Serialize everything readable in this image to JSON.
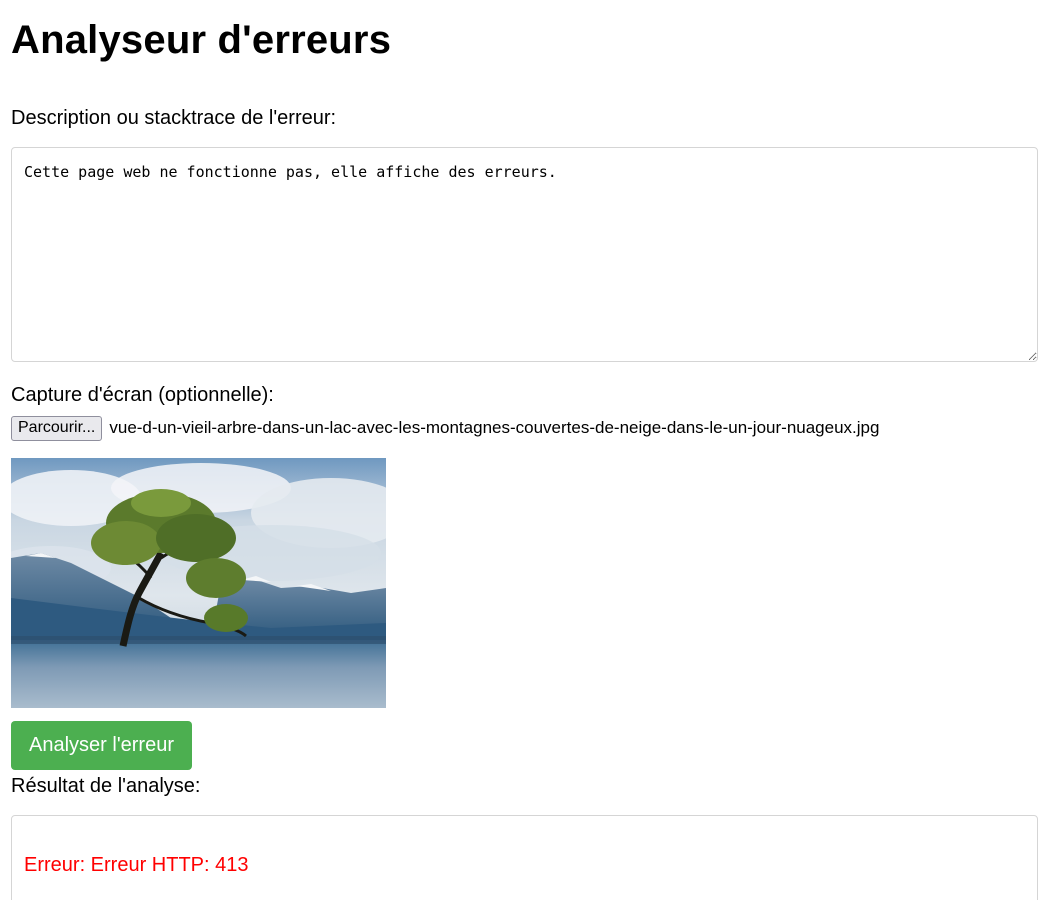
{
  "title": "Analyseur d'erreurs",
  "description": {
    "label": "Description ou stacktrace de l'erreur:",
    "value": "Cette page web ne fonctionne pas, elle affiche des erreurs."
  },
  "screenshot": {
    "label": "Capture d'écran (optionnelle):",
    "browse_label": "Parcourir...",
    "file_name": "vue-d-un-vieil-arbre-dans-un-lac-avec-les-montagnes-couvertes-de-neige-dans-le-un-jour-nuageux.jpg",
    "preview_icon": "landscape-photo-tree-in-lake"
  },
  "analyze_button": "Analyser l'erreur",
  "result": {
    "label": "Résultat de l'analyse:",
    "error": "Erreur: Erreur HTTP: 413"
  },
  "colors": {
    "button_green": "#4caf50",
    "error_red": "#ff0000"
  }
}
